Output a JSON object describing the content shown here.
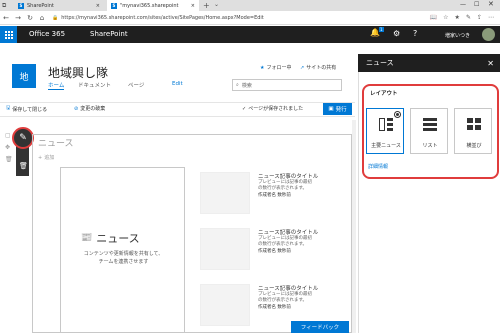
{
  "browser": {
    "tabs": [
      {
        "label": "SharePoint",
        "active": false
      },
      {
        "label": "\"mynavi365.sharepoint",
        "active": true
      }
    ],
    "url": "https://mynavi365.sharepoint.com/sites/active/SitePages/Home.aspx?Mode=Edit"
  },
  "suitebar": {
    "brand": "Office 365",
    "app": "SharePoint",
    "notification_count": "1",
    "user_name": "増家いつき"
  },
  "site": {
    "logo_text": "地",
    "title": "地域興し隊",
    "nav": [
      "ホーム",
      "ドキュメント",
      "ページ",
      "Edit"
    ],
    "follow_label": "フォロー中",
    "share_label": "サイトの共有",
    "search_placeholder": "検索"
  },
  "commandbar": {
    "save_close": "保存して閉じる",
    "discard": "変更の破棄",
    "saved_status": "ページが保存されました",
    "publish": "発行"
  },
  "canvas": {
    "news_title": "ニュース",
    "add_label": "追加",
    "hero_title": "ニュース",
    "hero_desc_line1": "コンテンツや更新情報を共有して、",
    "hero_desc_line2": "チームを連携させます",
    "items": [
      {
        "title": "ニュース記事のタイトル",
        "desc1": "プレビューには記事の最初",
        "desc2": "の数行が表示されます。",
        "author": "作成者名 数秒前"
      },
      {
        "title": "ニュース記事のタイトル",
        "desc1": "プレビューには記事の最初",
        "desc2": "の数行が表示されます。",
        "author": "作成者名 数秒前"
      },
      {
        "title": "ニュース記事のタイトル",
        "desc1": "プレビューには記事の最初",
        "desc2": "の数行が表示されます。",
        "author": "作成者名 数秒前"
      }
    ],
    "feedback": "フィードバック"
  },
  "panel": {
    "title": "ニュース",
    "section_label": "レイアウト",
    "options": [
      {
        "label": "主要ニュース",
        "selected": true
      },
      {
        "label": "リスト",
        "selected": false
      },
      {
        "label": "横並び",
        "selected": false
      }
    ],
    "details_link": "詳細情報"
  },
  "colors": {
    "accent": "#0078d4",
    "suitebar": "#1f1f1f",
    "highlight": "#e03c3c"
  }
}
